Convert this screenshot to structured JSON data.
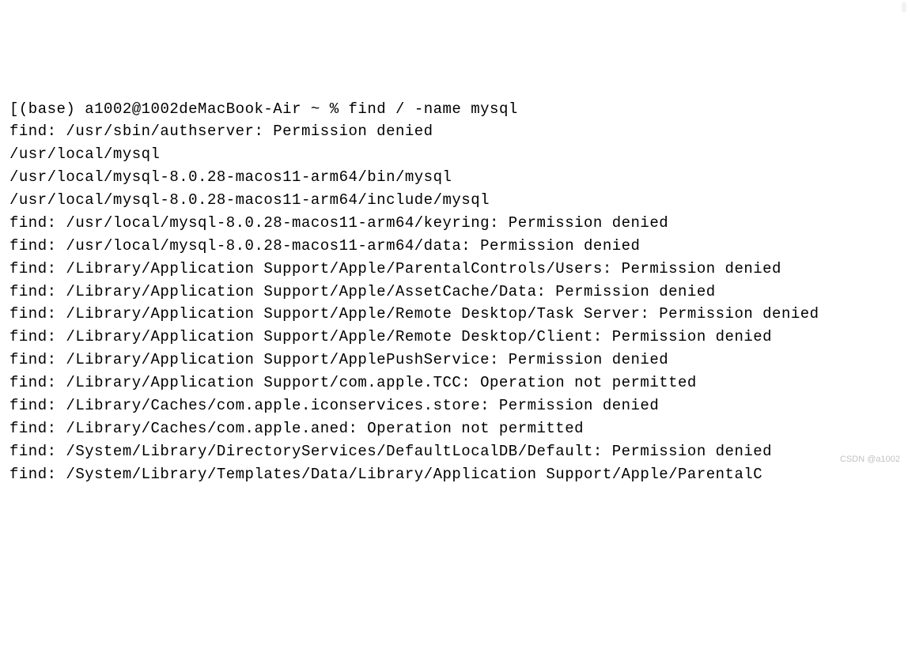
{
  "terminal": {
    "prompt": {
      "open_bracket": "[",
      "env": "(base)",
      "userhost": "a1002@1002deMacBook-Air",
      "path": "~",
      "symbol": "%",
      "command": "find / -name mysql"
    },
    "lines": [
      "find: /usr/sbin/authserver: Permission denied",
      "/usr/local/mysql",
      "/usr/local/mysql-8.0.28-macos11-arm64/bin/mysql",
      "/usr/local/mysql-8.0.28-macos11-arm64/include/mysql",
      "find: /usr/local/mysql-8.0.28-macos11-arm64/keyring: Permission denied",
      "find: /usr/local/mysql-8.0.28-macos11-arm64/data: Permission denied",
      "find: /Library/Application Support/Apple/ParentalControls/Users: Permission denied",
      "find: /Library/Application Support/Apple/AssetCache/Data: Permission denied",
      "find: /Library/Application Support/Apple/Remote Desktop/Task Server: Permission denied",
      "find: /Library/Application Support/Apple/Remote Desktop/Client: Permission denied",
      "find: /Library/Application Support/ApplePushService: Permission denied",
      "find: /Library/Application Support/com.apple.TCC: Operation not permitted",
      "find: /Library/Caches/com.apple.iconservices.store: Permission denied",
      "find: /Library/Caches/com.apple.aned: Operation not permitted",
      "find: /System/Library/DirectoryServices/DefaultLocalDB/Default: Permission denied",
      "find: /System/Library/Templates/Data/Library/Application Support/Apple/ParentalC"
    ],
    "watermark": "CSDN @a1002"
  }
}
